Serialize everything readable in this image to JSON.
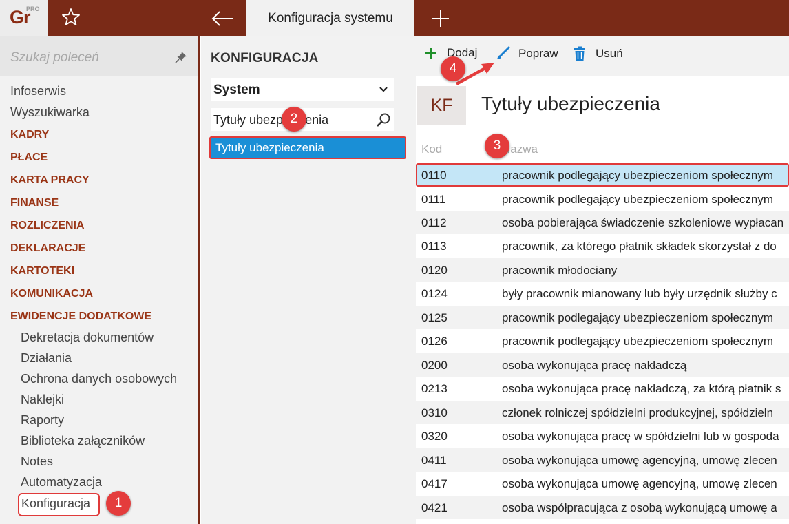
{
  "app": {
    "logo_text": "Gr",
    "logo_badge": "PRO"
  },
  "tabs": {
    "active_label": "Konfiguracja systemu"
  },
  "colors": {
    "brand": "#7a2a17",
    "section": "#9a3516",
    "selection": "#1a8fd6",
    "row_selected": "#c4e6f7",
    "callout": "#e43c3c",
    "add_icon": "#1f8f2a",
    "edit_icon": "#1a7fd0",
    "delete_icon": "#1a7fd0"
  },
  "icons": {
    "favorite": "star-icon",
    "back": "arrow-left-icon",
    "new_tab": "plus-icon",
    "pin": "pin-icon",
    "dropdown": "chevron-down-icon",
    "search": "magnifier-icon",
    "add": "plus-icon",
    "edit": "brush-icon",
    "delete": "trash-icon"
  },
  "sidebar": {
    "search_placeholder": "Szukaj poleceń",
    "items": [
      "Infoserwis",
      "Wyszukiwarka"
    ],
    "sections": [
      "KADRY",
      "PŁACE",
      "KARTA PRACY",
      "FINANSE",
      "ROZLICZENIA",
      "DEKLARACJE",
      "KARTOTEKI",
      "KOMUNIKACJA",
      "EWIDENCJE DODATKOWE"
    ],
    "subitems": [
      "Dekretacja dokumentów",
      "Działania",
      "Ochrona danych osobowych",
      "Naklejki",
      "Raporty",
      "Biblioteka załączników",
      "Notes",
      "Automatyzacja"
    ],
    "active_item": "Konfiguracja"
  },
  "config": {
    "title": "KONFIGURACJA",
    "module_select": "System",
    "filter_value": "Tytuły ubezpieczenia",
    "selected_item": "Tytuły ubezpieczenia"
  },
  "toolbar": {
    "add": "Dodaj",
    "edit": "Popraw",
    "delete": "Usuń"
  },
  "main": {
    "badge": "KF",
    "title": "Tytuły ubezpieczenia",
    "columns": [
      "Kod",
      "Nazwa"
    ],
    "rows": [
      {
        "code": "0110",
        "name": "pracownik podlegający ubezpieczeniom społecznym"
      },
      {
        "code": "0111",
        "name": "pracownik podlegający ubezpieczeniom społecznym"
      },
      {
        "code": "0112",
        "name": "osoba pobierająca świadczenie szkoleniowe wypłacan"
      },
      {
        "code": "0113",
        "name": "pracownik, za którego płatnik składek skorzystał z do"
      },
      {
        "code": "0120",
        "name": "pracownik młodociany"
      },
      {
        "code": "0124",
        "name": "były pracownik mianowany lub były urzędnik służby c"
      },
      {
        "code": "0125",
        "name": "pracownik podlegający ubezpieczeniom społecznym"
      },
      {
        "code": "0126",
        "name": "pracownik podlegający ubezpieczeniom społecznym"
      },
      {
        "code": "0200",
        "name": "osoba wykonująca pracę nakładczą"
      },
      {
        "code": "0213",
        "name": "osoba wykonująca pracę nakładczą, za którą płatnik s"
      },
      {
        "code": "0310",
        "name": "członek rolniczej spółdzielni produkcyjnej, spółdzieln"
      },
      {
        "code": "0320",
        "name": "osoba wykonująca pracę w spółdzielni lub w gospoda"
      },
      {
        "code": "0411",
        "name": "osoba wykonująca umowę agencyjną, umowę zlecen"
      },
      {
        "code": "0417",
        "name": "osoba wykonująca umowę agencyjną, umowę zlecen"
      },
      {
        "code": "0421",
        "name": "osoba współpracująca z osobą wykonującą umowę a"
      }
    ]
  },
  "callouts": [
    "1",
    "2",
    "3",
    "4"
  ]
}
